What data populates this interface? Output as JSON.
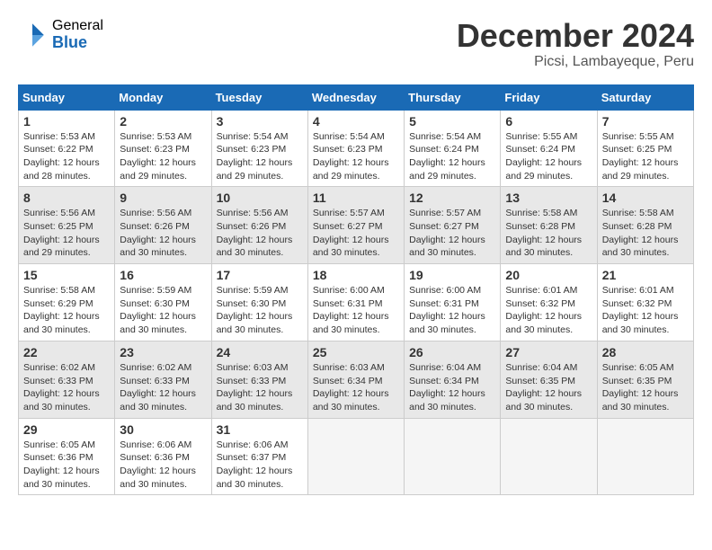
{
  "logo": {
    "general": "General",
    "blue": "Blue"
  },
  "title": "December 2024",
  "subtitle": "Picsi, Lambayeque, Peru",
  "days_of_week": [
    "Sunday",
    "Monday",
    "Tuesday",
    "Wednesday",
    "Thursday",
    "Friday",
    "Saturday"
  ],
  "weeks": [
    [
      {
        "day": "1",
        "sunrise": "5:53 AM",
        "sunset": "6:22 PM",
        "daylight": "12 hours and 28 minutes."
      },
      {
        "day": "2",
        "sunrise": "5:53 AM",
        "sunset": "6:23 PM",
        "daylight": "12 hours and 29 minutes."
      },
      {
        "day": "3",
        "sunrise": "5:54 AM",
        "sunset": "6:23 PM",
        "daylight": "12 hours and 29 minutes."
      },
      {
        "day": "4",
        "sunrise": "5:54 AM",
        "sunset": "6:23 PM",
        "daylight": "12 hours and 29 minutes."
      },
      {
        "day": "5",
        "sunrise": "5:54 AM",
        "sunset": "6:24 PM",
        "daylight": "12 hours and 29 minutes."
      },
      {
        "day": "6",
        "sunrise": "5:55 AM",
        "sunset": "6:24 PM",
        "daylight": "12 hours and 29 minutes."
      },
      {
        "day": "7",
        "sunrise": "5:55 AM",
        "sunset": "6:25 PM",
        "daylight": "12 hours and 29 minutes."
      }
    ],
    [
      {
        "day": "8",
        "sunrise": "5:56 AM",
        "sunset": "6:25 PM",
        "daylight": "12 hours and 29 minutes."
      },
      {
        "day": "9",
        "sunrise": "5:56 AM",
        "sunset": "6:26 PM",
        "daylight": "12 hours and 30 minutes."
      },
      {
        "day": "10",
        "sunrise": "5:56 AM",
        "sunset": "6:26 PM",
        "daylight": "12 hours and 30 minutes."
      },
      {
        "day": "11",
        "sunrise": "5:57 AM",
        "sunset": "6:27 PM",
        "daylight": "12 hours and 30 minutes."
      },
      {
        "day": "12",
        "sunrise": "5:57 AM",
        "sunset": "6:27 PM",
        "daylight": "12 hours and 30 minutes."
      },
      {
        "day": "13",
        "sunrise": "5:58 AM",
        "sunset": "6:28 PM",
        "daylight": "12 hours and 30 minutes."
      },
      {
        "day": "14",
        "sunrise": "5:58 AM",
        "sunset": "6:28 PM",
        "daylight": "12 hours and 30 minutes."
      }
    ],
    [
      {
        "day": "15",
        "sunrise": "5:58 AM",
        "sunset": "6:29 PM",
        "daylight": "12 hours and 30 minutes."
      },
      {
        "day": "16",
        "sunrise": "5:59 AM",
        "sunset": "6:30 PM",
        "daylight": "12 hours and 30 minutes."
      },
      {
        "day": "17",
        "sunrise": "5:59 AM",
        "sunset": "6:30 PM",
        "daylight": "12 hours and 30 minutes."
      },
      {
        "day": "18",
        "sunrise": "6:00 AM",
        "sunset": "6:31 PM",
        "daylight": "12 hours and 30 minutes."
      },
      {
        "day": "19",
        "sunrise": "6:00 AM",
        "sunset": "6:31 PM",
        "daylight": "12 hours and 30 minutes."
      },
      {
        "day": "20",
        "sunrise": "6:01 AM",
        "sunset": "6:32 PM",
        "daylight": "12 hours and 30 minutes."
      },
      {
        "day": "21",
        "sunrise": "6:01 AM",
        "sunset": "6:32 PM",
        "daylight": "12 hours and 30 minutes."
      }
    ],
    [
      {
        "day": "22",
        "sunrise": "6:02 AM",
        "sunset": "6:33 PM",
        "daylight": "12 hours and 30 minutes."
      },
      {
        "day": "23",
        "sunrise": "6:02 AM",
        "sunset": "6:33 PM",
        "daylight": "12 hours and 30 minutes."
      },
      {
        "day": "24",
        "sunrise": "6:03 AM",
        "sunset": "6:33 PM",
        "daylight": "12 hours and 30 minutes."
      },
      {
        "day": "25",
        "sunrise": "6:03 AM",
        "sunset": "6:34 PM",
        "daylight": "12 hours and 30 minutes."
      },
      {
        "day": "26",
        "sunrise": "6:04 AM",
        "sunset": "6:34 PM",
        "daylight": "12 hours and 30 minutes."
      },
      {
        "day": "27",
        "sunrise": "6:04 AM",
        "sunset": "6:35 PM",
        "daylight": "12 hours and 30 minutes."
      },
      {
        "day": "28",
        "sunrise": "6:05 AM",
        "sunset": "6:35 PM",
        "daylight": "12 hours and 30 minutes."
      }
    ],
    [
      {
        "day": "29",
        "sunrise": "6:05 AM",
        "sunset": "6:36 PM",
        "daylight": "12 hours and 30 minutes."
      },
      {
        "day": "30",
        "sunrise": "6:06 AM",
        "sunset": "6:36 PM",
        "daylight": "12 hours and 30 minutes."
      },
      {
        "day": "31",
        "sunrise": "6:06 AM",
        "sunset": "6:37 PM",
        "daylight": "12 hours and 30 minutes."
      },
      null,
      null,
      null,
      null
    ]
  ],
  "shaded_rows": [
    1,
    3
  ]
}
